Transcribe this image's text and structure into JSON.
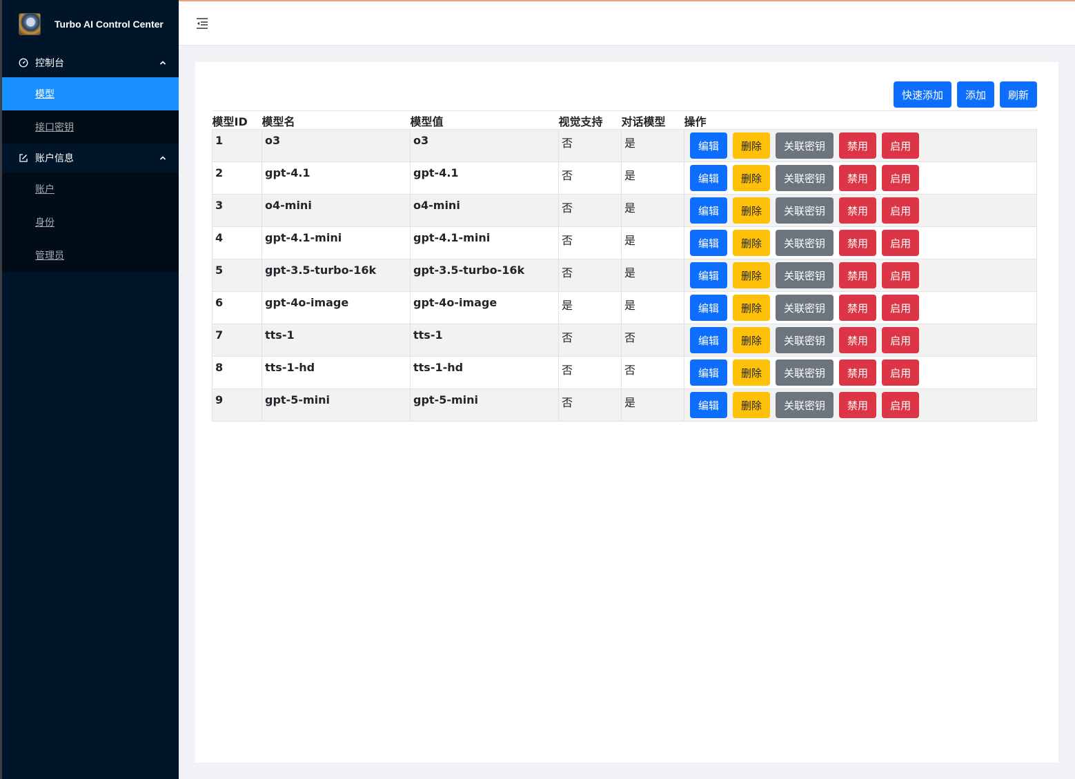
{
  "app": {
    "title": "Turbo AI Control Center"
  },
  "sidebar": {
    "groups": [
      {
        "label": "控制台",
        "icon": "dashboard-icon",
        "items": [
          {
            "label": "模型",
            "active": true
          },
          {
            "label": "接口密钥",
            "active": false
          }
        ]
      },
      {
        "label": "账户信息",
        "icon": "edit-icon",
        "items": [
          {
            "label": "账户",
            "active": false
          },
          {
            "label": "身份",
            "active": false
          },
          {
            "label": "管理员",
            "active": false
          }
        ]
      }
    ]
  },
  "toolbar": {
    "quick_add_label": "快速添加",
    "add_label": "添加",
    "refresh_label": "刷新"
  },
  "table": {
    "headers": [
      "模型ID",
      "模型名",
      "模型值",
      "视觉支持",
      "对话模型",
      "操作"
    ],
    "actions": {
      "edit": "编辑",
      "delete": "删除",
      "link_key": "关联密钥",
      "disable": "禁用",
      "enable": "启用"
    },
    "rows": [
      {
        "id": "1",
        "name": "o3",
        "value": "o3",
        "vision": "否",
        "chat": "是"
      },
      {
        "id": "2",
        "name": "gpt-4.1",
        "value": "gpt-4.1",
        "vision": "否",
        "chat": "是"
      },
      {
        "id": "3",
        "name": "o4-mini",
        "value": "o4-mini",
        "vision": "否",
        "chat": "是"
      },
      {
        "id": "4",
        "name": "gpt-4.1-mini",
        "value": "gpt-4.1-mini",
        "vision": "否",
        "chat": "是"
      },
      {
        "id": "5",
        "name": "gpt-3.5-turbo-16k",
        "value": "gpt-3.5-turbo-16k",
        "vision": "否",
        "chat": "是"
      },
      {
        "id": "6",
        "name": "gpt-4o-image",
        "value": "gpt-4o-image",
        "vision": "是",
        "chat": "是"
      },
      {
        "id": "7",
        "name": "tts-1",
        "value": "tts-1",
        "vision": "否",
        "chat": "否"
      },
      {
        "id": "8",
        "name": "tts-1-hd",
        "value": "tts-1-hd",
        "vision": "否",
        "chat": "否"
      },
      {
        "id": "9",
        "name": "gpt-5-mini",
        "value": "gpt-5-mini",
        "vision": "否",
        "chat": "是"
      }
    ]
  },
  "colors": {
    "sidebar_bg": "#001529",
    "submenu_bg": "#000c17",
    "active_item": "#1890ff",
    "primary": "#0d6efd",
    "warning": "#ffc107",
    "secondary": "#6c757d",
    "danger": "#dc3545"
  }
}
